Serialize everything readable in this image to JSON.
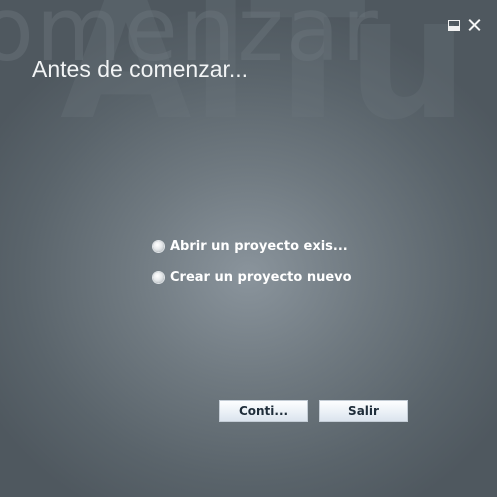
{
  "window": {
    "watermark_text": "omenzar",
    "watermark_large": "Antes",
    "title": "Antes de comenzar..."
  },
  "options": [
    {
      "label": "Abrir un proyecto exis...",
      "icon": "radio-icon"
    },
    {
      "label": "Crear un proyecto nuevo",
      "icon": "radio-icon"
    }
  ],
  "buttons": {
    "continue_label": "Conti...",
    "exit_label": "Salir"
  },
  "colors": {
    "background_center": "#8a949c",
    "background_edge": "#4f585f",
    "title_text": "#f2f4f5",
    "button_text": "#1f2d3a"
  }
}
